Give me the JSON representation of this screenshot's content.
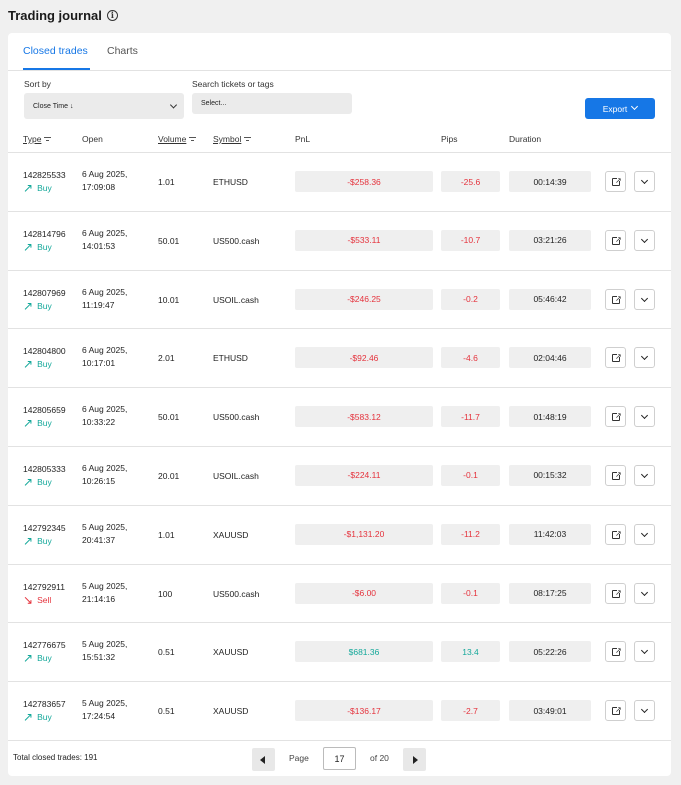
{
  "header": {
    "title": "Trading journal",
    "info_icon": "info-icon"
  },
  "tabs": [
    {
      "label": "Closed trades",
      "active": true
    },
    {
      "label": "Charts",
      "active": false
    }
  ],
  "filters": {
    "sort_label": "Sort by",
    "sort_value": "Close Time ↓",
    "search_label": "Search tickets or tags",
    "search_value": "Select..."
  },
  "export_label": "Export",
  "columns": {
    "type": "Type",
    "open": "Open",
    "volume": "Volume",
    "symbol": "Symbol",
    "pnl": "PnL",
    "pips": "Pips",
    "duration": "Duration"
  },
  "trades": [
    {
      "ticket": "142825533",
      "direction": "Buy",
      "open_date": "6 Aug 2025,",
      "open_time": "17:09:08",
      "volume": "1.01",
      "symbol": "ETHUSD",
      "pnl": "-$258.36",
      "pips": "-25.6",
      "duration": "00:14:39",
      "positive": false
    },
    {
      "ticket": "142814796",
      "direction": "Buy",
      "open_date": "6 Aug 2025,",
      "open_time": "14:01:53",
      "volume": "50.01",
      "symbol": "US500.cash",
      "pnl": "-$533.11",
      "pips": "-10.7",
      "duration": "03:21:26",
      "positive": false
    },
    {
      "ticket": "142807969",
      "direction": "Buy",
      "open_date": "6 Aug 2025,",
      "open_time": "11:19:47",
      "volume": "10.01",
      "symbol": "USOIL.cash",
      "pnl": "-$246.25",
      "pips": "-0.2",
      "duration": "05:46:42",
      "positive": false
    },
    {
      "ticket": "142804800",
      "direction": "Buy",
      "open_date": "6 Aug 2025,",
      "open_time": "10:17:01",
      "volume": "2.01",
      "symbol": "ETHUSD",
      "pnl": "-$92.46",
      "pips": "-4.6",
      "duration": "02:04:46",
      "positive": false
    },
    {
      "ticket": "142805659",
      "direction": "Buy",
      "open_date": "6 Aug 2025,",
      "open_time": "10:33:22",
      "volume": "50.01",
      "symbol": "US500.cash",
      "pnl": "-$583.12",
      "pips": "-11.7",
      "duration": "01:48:19",
      "positive": false
    },
    {
      "ticket": "142805333",
      "direction": "Buy",
      "open_date": "6 Aug 2025,",
      "open_time": "10:26:15",
      "volume": "20.01",
      "symbol": "USOIL.cash",
      "pnl": "-$224.11",
      "pips": "-0.1",
      "duration": "00:15:32",
      "positive": false
    },
    {
      "ticket": "142792345",
      "direction": "Buy",
      "open_date": "5 Aug 2025,",
      "open_time": "20:41:37",
      "volume": "1.01",
      "symbol": "XAUUSD",
      "pnl": "-$1,131.20",
      "pips": "-11.2",
      "duration": "11:42:03",
      "positive": false
    },
    {
      "ticket": "142792911",
      "direction": "Sell",
      "open_date": "5 Aug 2025,",
      "open_time": "21:14:16",
      "volume": "100",
      "symbol": "US500.cash",
      "pnl": "-$6.00",
      "pips": "-0.1",
      "duration": "08:17:25",
      "positive": false
    },
    {
      "ticket": "142776675",
      "direction": "Buy",
      "open_date": "5 Aug 2025,",
      "open_time": "15:51:32",
      "volume": "0.51",
      "symbol": "XAUUSD",
      "pnl": "$681.36",
      "pips": "13.4",
      "duration": "05:22:26",
      "positive": true
    },
    {
      "ticket": "142783657",
      "direction": "Buy",
      "open_date": "5 Aug 2025,",
      "open_time": "17:24:54",
      "volume": "0.51",
      "symbol": "XAUUSD",
      "pnl": "-$136.17",
      "pips": "-2.7",
      "duration": "03:49:01",
      "positive": false
    }
  ],
  "footer": {
    "total": "Total closed trades: 191",
    "page_label": "Page",
    "page_value": "17",
    "of_label": "of 20"
  },
  "colors": {
    "accent": "#1677e6",
    "positive": "#14a89a",
    "negative": "#e5323c"
  }
}
